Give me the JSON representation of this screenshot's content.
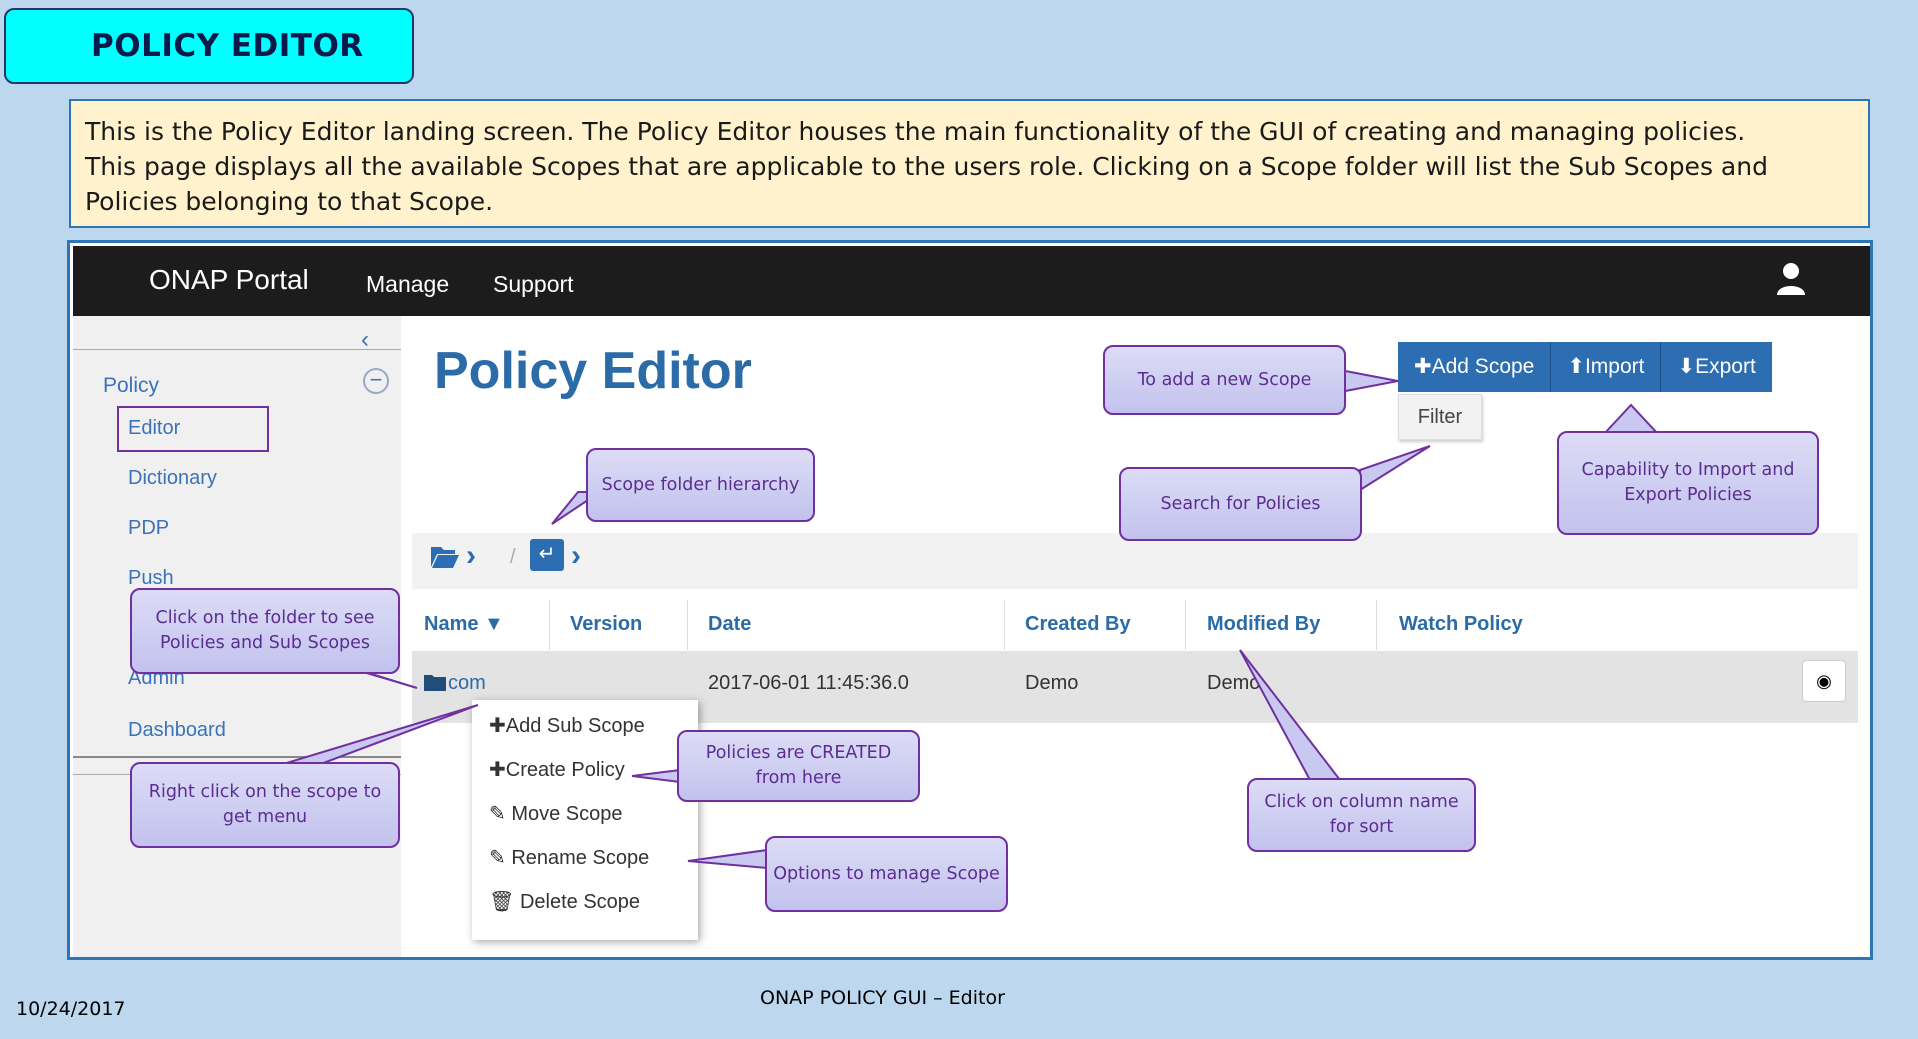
{
  "slide": {
    "title": "POLICY  EDITOR",
    "description_line1": "This is the Policy Editor landing screen. The Policy Editor houses the main functionality of the GUI of creating and managing policies.",
    "description_line2": "This page displays all the available Scopes that are applicable to the users role.  Clicking on a Scope folder will list the Sub Scopes and Policies belonging to that Scope.",
    "footer_date": "10/24/2017",
    "footer_center": "ONAP  POLICY  GUI – Editor"
  },
  "topnav": {
    "brand": "ONAP Portal",
    "items": [
      "Manage",
      "Support"
    ],
    "user_icon": "user-icon"
  },
  "sidebar": {
    "section": "Policy",
    "items": [
      "Editor",
      "Dictionary",
      "PDP",
      "Push",
      "Admin",
      "Dashboard"
    ],
    "selected": "Editor"
  },
  "main": {
    "title": "Policy Editor",
    "buttons": {
      "add_scope": "Add Scope",
      "import": "Import",
      "export": "Export",
      "filter": "Filter"
    },
    "columns": [
      "Name ▼",
      "Version",
      "Date",
      "Created By",
      "Modified By",
      "Watch Policy"
    ],
    "rows": [
      {
        "name": "com",
        "version": "",
        "date": "2017-06-01 11:45:36.0",
        "created_by": "Demo",
        "modified_by": "Demo"
      }
    ],
    "context_menu": [
      "Add Sub Scope",
      "Create Policy",
      "Move Scope",
      "Rename Scope",
      "Delete Scope"
    ]
  },
  "callouts": {
    "add_scope": "To add a new Scope",
    "import_export": "Capability to Import and Export Policies",
    "search": "Search for Policies",
    "folder_hierarchy": "Scope folder hierarchy",
    "click_folder": "Click on the folder to see Policies and Sub Scopes",
    "right_click": "Right click on the scope to get menu",
    "policies_created": "Policies are CREATED from here",
    "options": "Options to manage Scope",
    "sort": "Click on column name for sort"
  },
  "colors": {
    "background": "#bdd7ee",
    "title_fill": "#00ffff",
    "description_fill": "#fff2cc",
    "accent_blue": "#2d6eb3",
    "callout_border": "#7030a0"
  }
}
